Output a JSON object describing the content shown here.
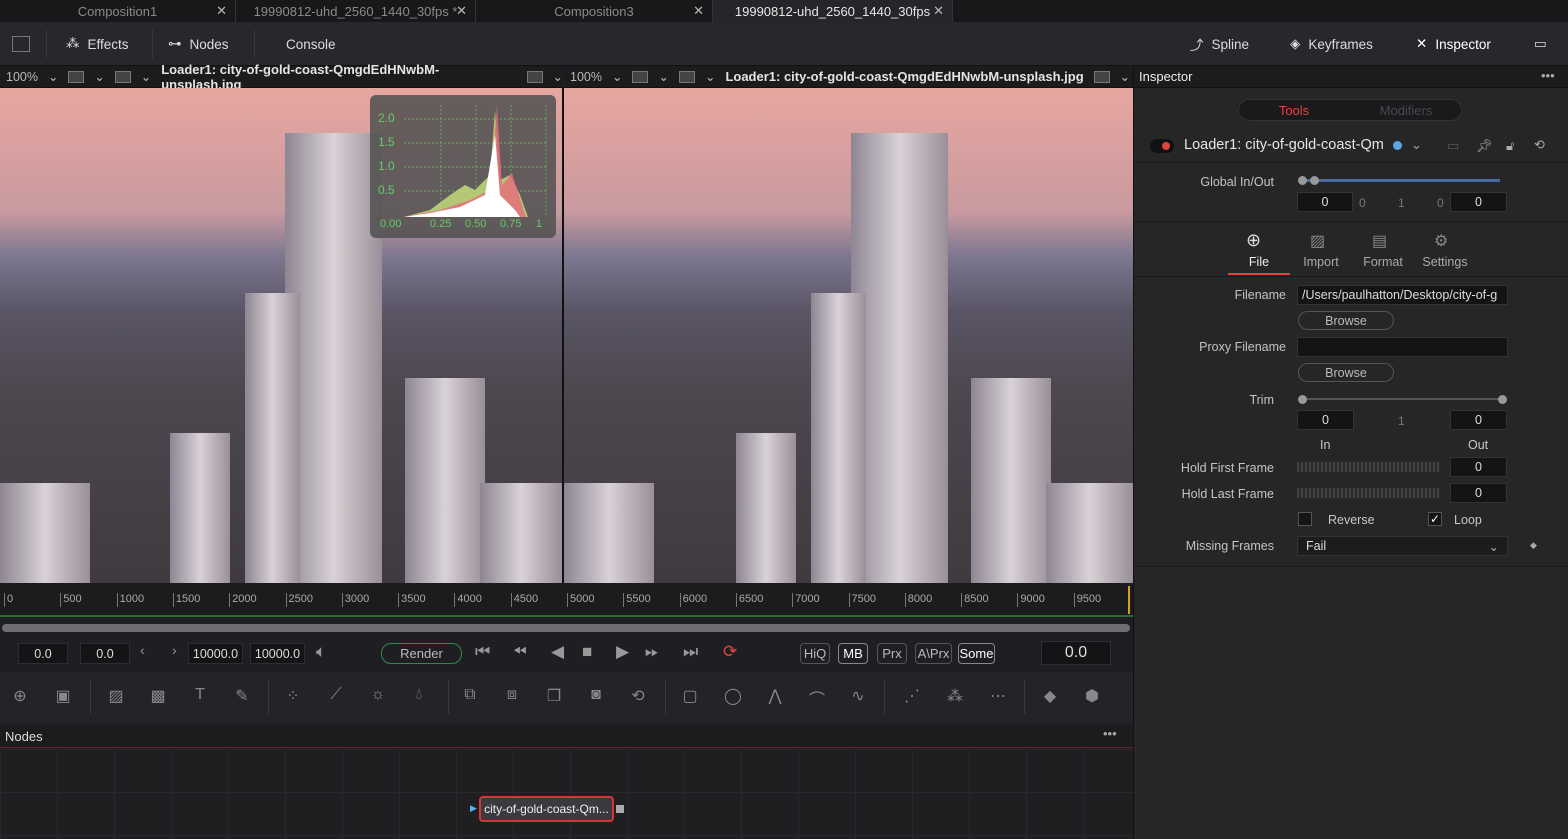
{
  "tabs": [
    {
      "label": "Composition1",
      "active": false
    },
    {
      "label": "19990812-uhd_2560_1440_30fps *",
      "active": false
    },
    {
      "label": "Composition3",
      "active": false
    },
    {
      "label": "19990812-uhd_2560_1440_30fps",
      "active": true
    }
  ],
  "toolbar": {
    "effects": "Effects",
    "nodes": "Nodes",
    "console": "Console",
    "spline": "Spline",
    "keyframes": "Keyframes",
    "inspector": "Inspector"
  },
  "viewers": [
    {
      "zoom": "100%",
      "title": "Loader1: city-of-gold-coast-QmgdEdHNwbM-unsplash.jpg"
    },
    {
      "zoom": "100%",
      "title": "Loader1: city-of-gold-coast-QmgdEdHNwbM-unsplash.jpg"
    }
  ],
  "histogram": {
    "y_labels": [
      "2.0",
      "1.5",
      "1.0",
      "0.5"
    ],
    "x_labels": [
      "0.00",
      "0.25",
      "0.50",
      "0.75",
      "1"
    ]
  },
  "ruler": [
    "0",
    "500",
    "1000",
    "1500",
    "2000",
    "2500",
    "3000",
    "3500",
    "4000",
    "4500",
    "5000",
    "5500",
    "6000",
    "6500",
    "7000",
    "7500",
    "8000",
    "8500",
    "9000",
    "9500"
  ],
  "transport": {
    "start": "0.0",
    "render_start": "0.0",
    "render_end": "10000.0",
    "end": "10000.0",
    "render": "Render",
    "flags": [
      "HiQ",
      "MB",
      "Prx",
      "A\\Prx",
      "Some"
    ],
    "current": "0.0"
  },
  "nodes": {
    "title": "Nodes",
    "node_label": "city-of-gold-coast-Qm..."
  },
  "inspector": {
    "title": "Inspector",
    "tabs": [
      "Tools",
      "Modifiers"
    ],
    "tool_name": "Loader1: city-of-gold-coast-Qm",
    "global_in_out": "Global In/Out",
    "global_values": [
      "0",
      "0",
      "1",
      "0",
      "0"
    ],
    "subtabs": [
      "File",
      "Import",
      "Format",
      "Settings"
    ],
    "filename_label": "Filename",
    "filename": "/Users/paulhatton/Desktop/city-of-g",
    "browse": "Browse",
    "proxy_label": "Proxy Filename",
    "proxy": "",
    "trim_label": "Trim",
    "trim_in": "0",
    "trim_mid": "1",
    "trim_out": "0",
    "in_label": "In",
    "out_label": "Out",
    "hold_first_label": "Hold First Frame",
    "hold_first": "0",
    "hold_last_label": "Hold Last Frame",
    "hold_last": "0",
    "reverse": "Reverse",
    "reverse_checked": false,
    "loop": "Loop",
    "loop_checked": true,
    "missing_label": "Missing Frames",
    "missing": "Fail"
  },
  "colors": {
    "accent_red": "#e0443c",
    "render_green": "#2f8a4a",
    "tab_active": "#e6e6e6"
  }
}
